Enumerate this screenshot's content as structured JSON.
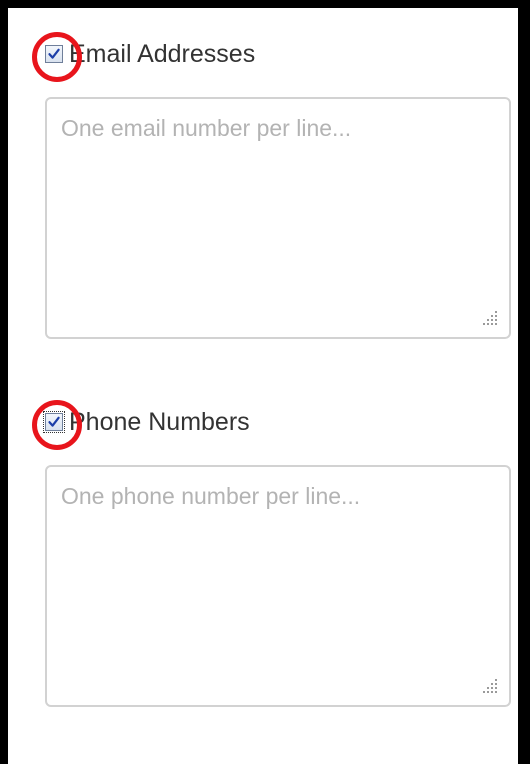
{
  "sections": [
    {
      "label": "Email Addresses",
      "checked": true,
      "placeholder": "One email number per line...",
      "value": ""
    },
    {
      "label": "Phone Numbers",
      "checked": true,
      "placeholder": "One phone number per line...",
      "value": ""
    }
  ],
  "icons": {
    "checkmark": "checkmark-icon",
    "resize": "resize-grip-icon",
    "highlight": "red-circle-annotation"
  },
  "colors": {
    "annotation": "#e8151c",
    "check": "#1d3fa8",
    "border": "#d2d2d2",
    "placeholder": "#b3b3b3",
    "frame": "#000000"
  }
}
